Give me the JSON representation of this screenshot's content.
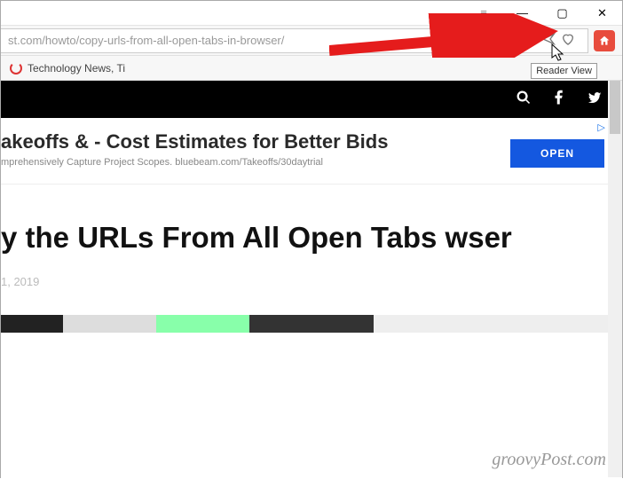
{
  "window": {
    "sidebar_glyph": "≡",
    "min_glyph": "—",
    "max_glyph": "▢",
    "close_glyph": "✕"
  },
  "addressbar": {
    "url_fragment": "st.com/howto/copy-urls-from-all-open-tabs-in-browser/"
  },
  "bookmarkbar": {
    "item1": "Technology News, Ti"
  },
  "tooltip": {
    "text": "Reader View"
  },
  "ad": {
    "title": "akeoffs & - Cost Estimates for Better Bids",
    "subtitle": "mprehensively Capture Project Scopes. bluebeam.com/Takeoffs/30daytrial",
    "button": "OPEN",
    "choices_arrow": "▷",
    "choices_x": "✕"
  },
  "article": {
    "headline": "y the URLs From All Open Tabs wser",
    "date": "1, 2019"
  },
  "watermark": "groovyPost.com"
}
